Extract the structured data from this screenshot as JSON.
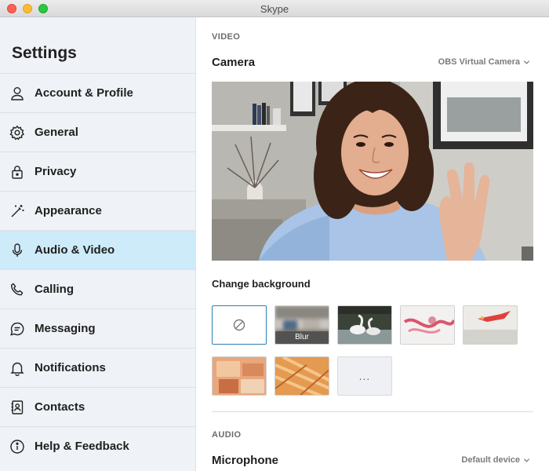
{
  "window": {
    "title": "Skype"
  },
  "sidebar": {
    "title": "Settings",
    "items": [
      {
        "label": "Account & Profile",
        "icon": "person-icon"
      },
      {
        "label": "General",
        "icon": "gear-icon"
      },
      {
        "label": "Privacy",
        "icon": "lock-icon"
      },
      {
        "label": "Appearance",
        "icon": "magic-wand-icon"
      },
      {
        "label": "Audio & Video",
        "icon": "microphone-icon",
        "active": true
      },
      {
        "label": "Calling",
        "icon": "phone-icon"
      },
      {
        "label": "Messaging",
        "icon": "chat-bubble-icon"
      },
      {
        "label": "Notifications",
        "icon": "bell-icon"
      },
      {
        "label": "Contacts",
        "icon": "contact-book-icon"
      },
      {
        "label": "Help & Feedback",
        "icon": "info-icon"
      }
    ]
  },
  "video": {
    "section_label": "VIDEO",
    "camera_label": "Camera",
    "camera_value": "OBS Virtual Camera",
    "change_background_label": "Change background",
    "backgrounds": [
      {
        "type": "none",
        "icon": "no-background-icon"
      },
      {
        "type": "blur",
        "caption": "Blur"
      },
      {
        "type": "image",
        "subject": "swans-on-lake"
      },
      {
        "type": "image",
        "subject": "pink-abstract-splash"
      },
      {
        "type": "image",
        "subject": "red-bird-abstract"
      },
      {
        "type": "image",
        "subject": "orange-patchwork"
      },
      {
        "type": "image",
        "subject": "orange-textured-art"
      },
      {
        "type": "more",
        "label": "..."
      }
    ]
  },
  "audio": {
    "section_label": "AUDIO",
    "microphone_label": "Microphone",
    "microphone_value": "Default device"
  },
  "colors": {
    "active_nav": "#cdebf9",
    "sidebar_bg": "#eff2f6",
    "selected_tile_border": "#2a7fb5"
  }
}
